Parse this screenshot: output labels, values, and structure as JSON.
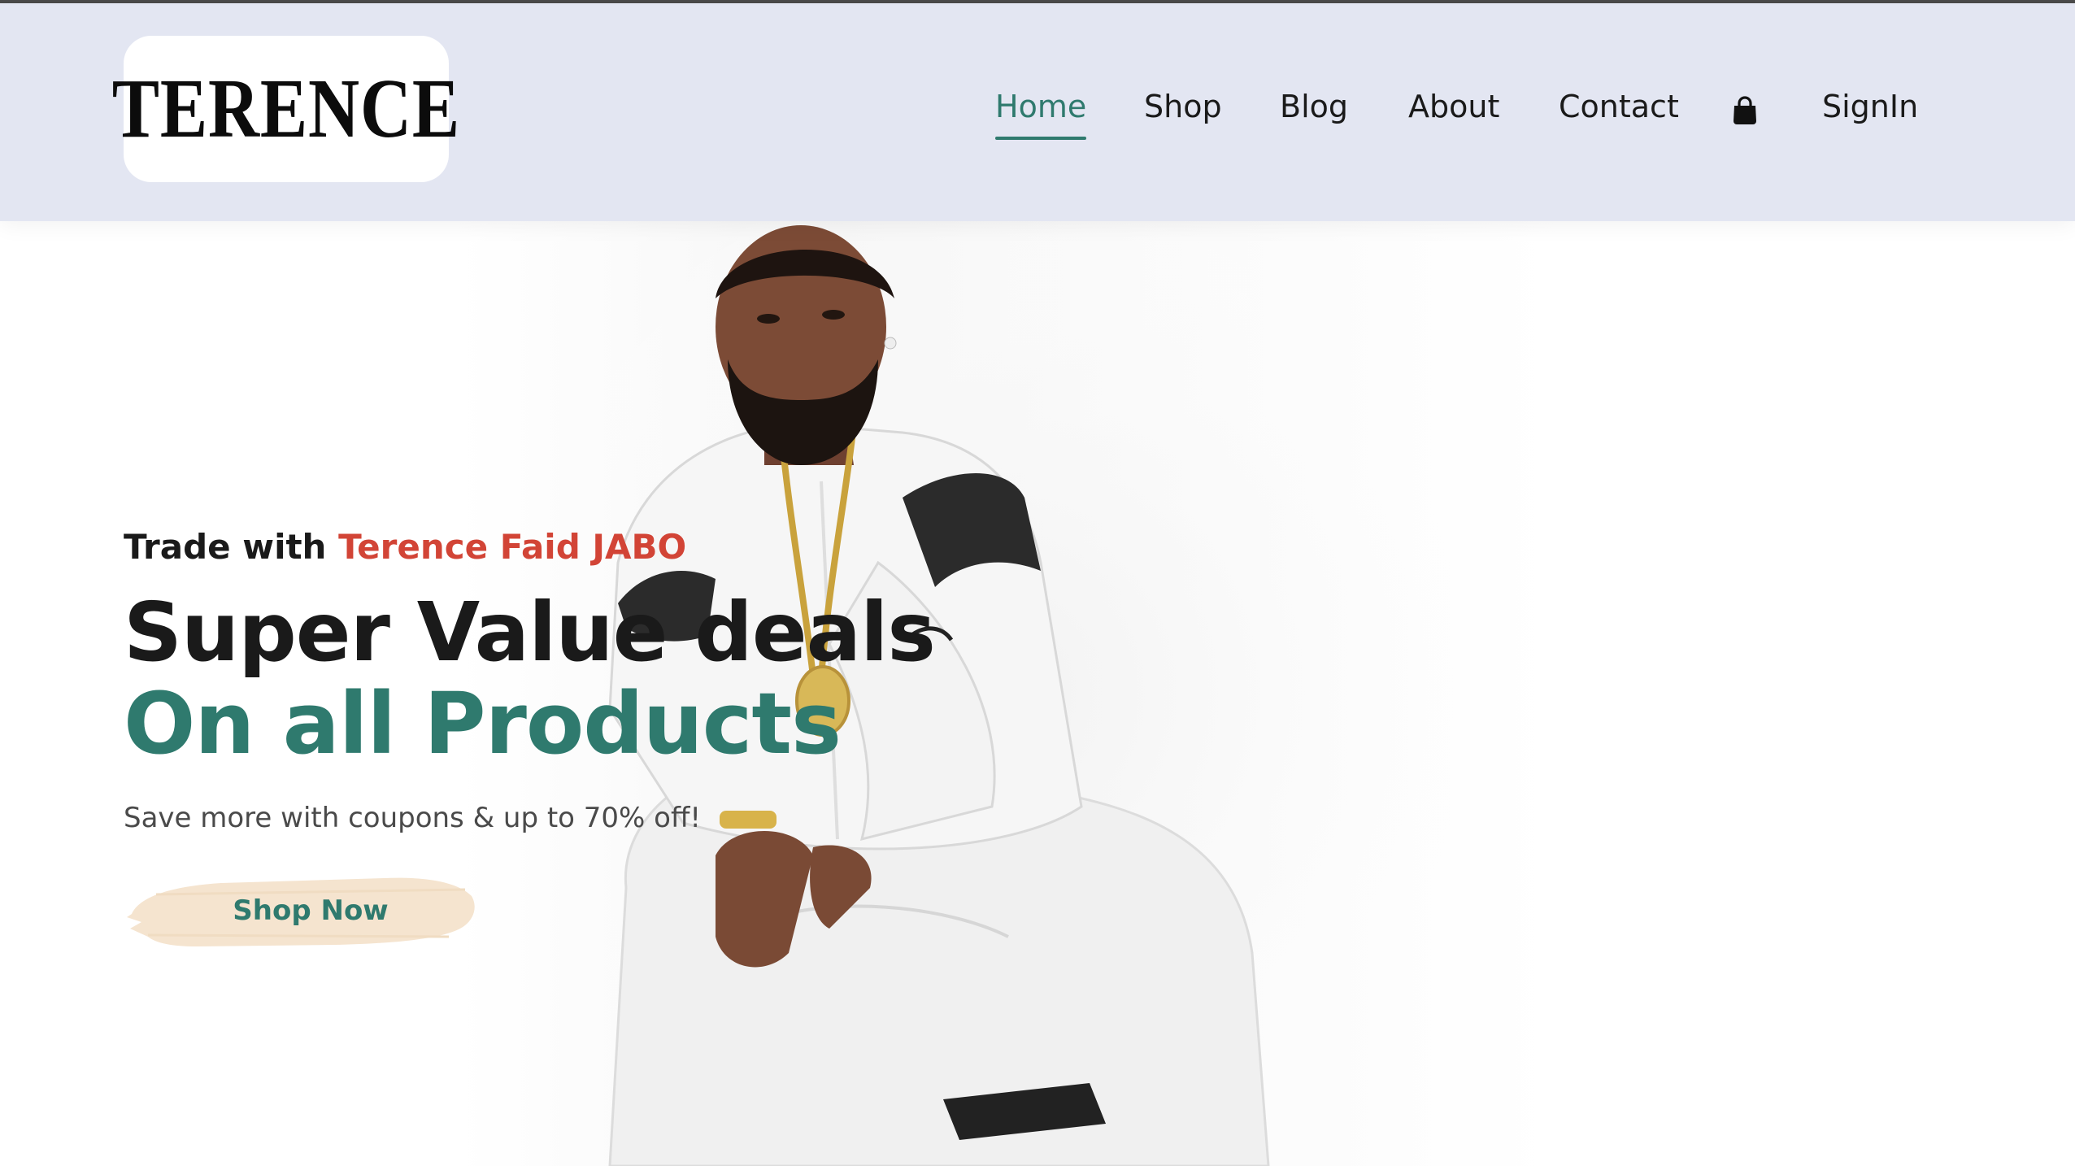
{
  "header": {
    "logo_text": "TERENCE",
    "nav": [
      {
        "label": "Home",
        "active": true
      },
      {
        "label": "Shop",
        "active": false
      },
      {
        "label": "Blog",
        "active": false
      },
      {
        "label": "About",
        "active": false
      },
      {
        "label": "Contact",
        "active": false
      }
    ],
    "cart_icon": "shopping-bag-icon",
    "signin_label": "SignIn"
  },
  "hero": {
    "eyebrow_prefix": "Trade with ",
    "eyebrow_name": "Terence Faid JABO",
    "headline_line1": "Super Value deals",
    "headline_line2": "On all Products",
    "subtext": "Save more with coupons & up to 70% off!",
    "cta_label": "Shop Now",
    "image_subject": "man in white tracksuit crouching"
  },
  "colors": {
    "header_bg": "#e3e6f2",
    "brand_green": "#2f7a6e",
    "accent_red": "#d24436",
    "cta_brush": "#f5e4cf",
    "text_dark": "#1a1a1a"
  }
}
